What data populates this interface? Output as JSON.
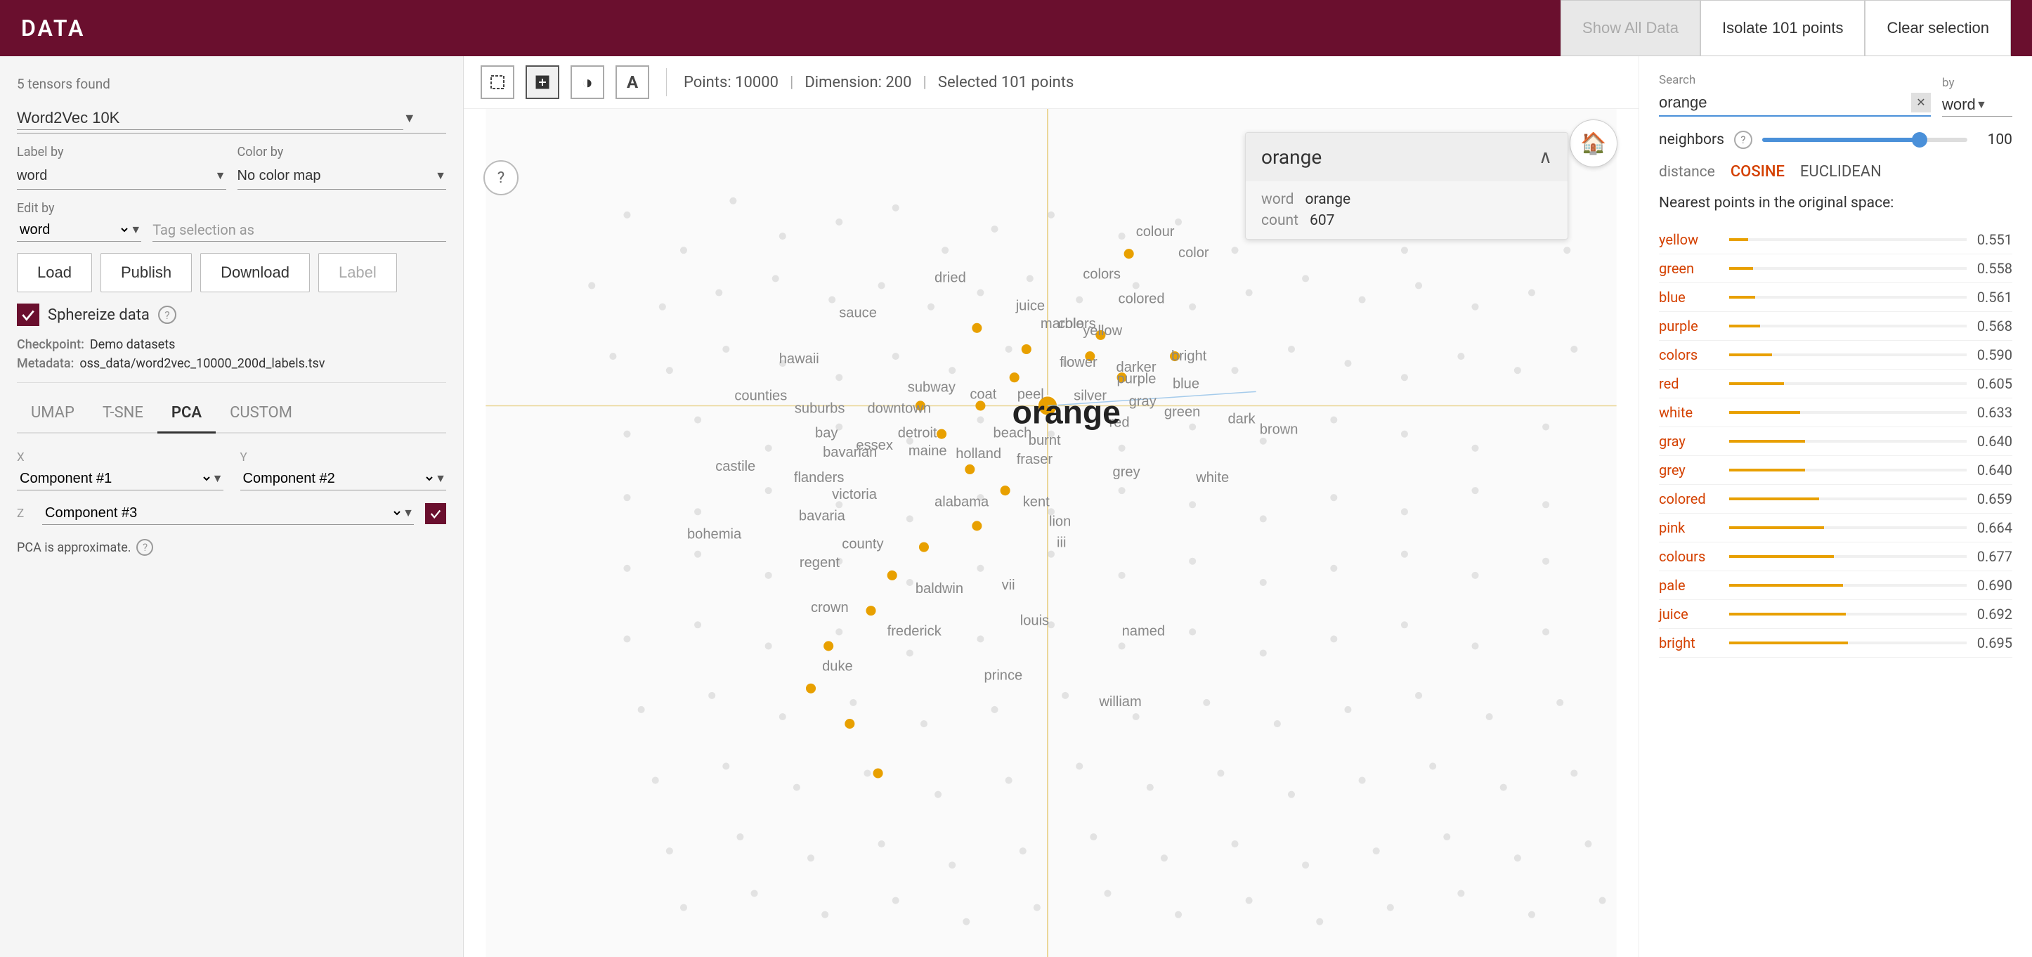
{
  "app": {
    "title": "DATA"
  },
  "top_bar": {
    "show_all_label": "Show All Data",
    "isolate_label": "Isolate 101 points",
    "clear_label": "Clear selection"
  },
  "left_panel": {
    "tensors_found": "5 tensors found",
    "dataset_label": "Word2Vec 10K",
    "label_by_label": "Label by",
    "label_by_value": "word",
    "color_by_label": "Color by",
    "color_by_value": "No color map",
    "edit_by_label": "Edit by",
    "edit_by_value": "word",
    "tag_label": "Tag selection as",
    "tag_placeholder": "",
    "btn_load": "Load",
    "btn_publish": "Publish",
    "btn_download": "Download",
    "btn_label": "Label",
    "sphereize_label": "Sphereize data",
    "checkpoint_label": "Checkpoint:",
    "checkpoint_val": "Demo datasets",
    "metadata_label": "Metadata:",
    "metadata_val": "oss_data/word2vec_10000_200d_labels.tsv",
    "proj_tabs": [
      "UMAP",
      "T-SNE",
      "PCA",
      "CUSTOM"
    ],
    "active_tab": "PCA",
    "axis_x_label": "X",
    "axis_x_value": "Component #1",
    "axis_y_label": "Y",
    "axis_y_value": "Component #2",
    "axis_z_label": "Z",
    "axis_z_value": "Component #3",
    "pca_note": "PCA is approximate."
  },
  "viz": {
    "points_label": "Points: 10000",
    "dimension_label": "Dimension: 200",
    "selected_label": "Selected 101 points",
    "separator": "|",
    "crosshair_icon": "⬚",
    "selection_icon": "⬚",
    "night_icon": "◑",
    "text_icon": "A"
  },
  "popup": {
    "word": "orange",
    "key_word": "word",
    "val_word": "orange",
    "key_count": "count",
    "val_count": "607"
  },
  "right_panel": {
    "search_label": "Search",
    "search_value": "orange",
    "by_label": "by",
    "by_value": "word",
    "neighbors_label": "neighbors",
    "neighbors_value": 100,
    "distance_label": "distance",
    "distance_cosine": "COSINE",
    "distance_euclidean": "EUCLIDEAN",
    "active_distance": "COSINE",
    "nearest_header": "Nearest points in the original space:",
    "nearest_points": [
      {
        "name": "yellow",
        "value": "0.551",
        "bar_pct": 8
      },
      {
        "name": "green",
        "value": "0.558",
        "bar_pct": 10
      },
      {
        "name": "blue",
        "value": "0.561",
        "bar_pct": 11
      },
      {
        "name": "purple",
        "value": "0.568",
        "bar_pct": 13
      },
      {
        "name": "colors",
        "value": "0.590",
        "bar_pct": 18
      },
      {
        "name": "red",
        "value": "0.605",
        "bar_pct": 23
      },
      {
        "name": "white",
        "value": "0.633",
        "bar_pct": 30
      },
      {
        "name": "gray",
        "value": "0.640",
        "bar_pct": 32
      },
      {
        "name": "grey",
        "value": "0.640",
        "bar_pct": 32
      },
      {
        "name": "colored",
        "value": "0.659",
        "bar_pct": 38
      },
      {
        "name": "pink",
        "value": "0.664",
        "bar_pct": 40
      },
      {
        "name": "colours",
        "value": "0.677",
        "bar_pct": 44
      },
      {
        "name": "pale",
        "value": "0.690",
        "bar_pct": 48
      },
      {
        "name": "juice",
        "value": "0.692",
        "bar_pct": 49
      },
      {
        "name": "bright",
        "value": "0.695",
        "bar_pct": 50
      }
    ]
  },
  "scatter": {
    "center_word": "orange",
    "words": [
      {
        "text": "colors",
        "x": 49.5,
        "y": 16
      },
      {
        "text": "colour",
        "x": 57,
        "y": 14
      },
      {
        "text": "color",
        "x": 62.5,
        "y": 17
      },
      {
        "text": "colors",
        "x": 50,
        "y": 20
      },
      {
        "text": "colored",
        "x": 56,
        "y": 22
      },
      {
        "text": "dried",
        "x": 42,
        "y": 21
      },
      {
        "text": "sauce",
        "x": 33,
        "y": 26
      },
      {
        "text": "juice",
        "x": 48,
        "y": 25
      },
      {
        "text": "marble",
        "x": 50,
        "y": 26
      },
      {
        "text": "yellow",
        "x": 53,
        "y": 26
      },
      {
        "text": "hawaii",
        "x": 27,
        "y": 30
      },
      {
        "text": "flower",
        "x": 51,
        "y": 30
      },
      {
        "text": "darker",
        "x": 56,
        "y": 31
      },
      {
        "text": "bright",
        "x": 62,
        "y": 29
      },
      {
        "text": "purple",
        "x": 56,
        "y": 32
      },
      {
        "text": "blue",
        "x": 62,
        "y": 33
      },
      {
        "text": "subway",
        "x": 39,
        "y": 33
      },
      {
        "text": "coat",
        "x": 44,
        "y": 35
      },
      {
        "text": "peel",
        "x": 48,
        "y": 35
      },
      {
        "text": "silver",
        "x": 53,
        "y": 35
      },
      {
        "text": "gray",
        "x": 58,
        "y": 36
      },
      {
        "text": "green",
        "x": 61,
        "y": 37
      },
      {
        "text": "counties",
        "x": 23,
        "y": 35
      },
      {
        "text": "suburbs",
        "x": 28,
        "y": 37
      },
      {
        "text": "downtown",
        "x": 35,
        "y": 37
      },
      {
        "text": "red",
        "x": 57,
        "y": 38
      },
      {
        "text": "dark",
        "x": 66,
        "y": 38
      },
      {
        "text": "bay",
        "x": 30,
        "y": 40
      },
      {
        "text": "detroit",
        "x": 37,
        "y": 40
      },
      {
        "text": "beach",
        "x": 46,
        "y": 40
      },
      {
        "text": "burnt",
        "x": 49,
        "y": 41
      },
      {
        "text": "brown",
        "x": 69,
        "y": 40
      },
      {
        "text": "essex",
        "x": 34,
        "y": 42
      },
      {
        "text": "bavarian",
        "x": 31,
        "y": 42
      },
      {
        "text": "maine",
        "x": 38,
        "y": 42
      },
      {
        "text": "holland",
        "x": 43,
        "y": 42
      },
      {
        "text": "fraser",
        "x": 48,
        "y": 43
      },
      {
        "text": "castile",
        "x": 21,
        "y": 44
      },
      {
        "text": "flanders",
        "x": 28,
        "y": 45
      },
      {
        "text": "grey",
        "x": 56,
        "y": 44
      },
      {
        "text": "white",
        "x": 63,
        "y": 44
      },
      {
        "text": "victoria",
        "x": 32,
        "y": 47
      },
      {
        "text": "alabama",
        "x": 40,
        "y": 47
      },
      {
        "text": "kent",
        "x": 48,
        "y": 47
      },
      {
        "text": "bavaria",
        "x": 28,
        "y": 49
      },
      {
        "text": "lion",
        "x": 50,
        "y": 49
      },
      {
        "text": "county",
        "x": 32,
        "y": 52
      },
      {
        "text": "iii",
        "x": 51,
        "y": 52
      },
      {
        "text": "bohemia",
        "x": 18,
        "y": 50
      },
      {
        "text": "regent",
        "x": 28,
        "y": 54
      },
      {
        "text": "vii",
        "x": 46,
        "y": 57
      },
      {
        "text": "baldwin",
        "x": 38,
        "y": 57
      },
      {
        "text": "crown",
        "x": 29,
        "y": 59
      },
      {
        "text": "louis",
        "x": 48,
        "y": 61
      },
      {
        "text": "frederick",
        "x": 36,
        "y": 62
      },
      {
        "text": "named",
        "x": 57,
        "y": 62
      },
      {
        "text": "duke",
        "x": 30,
        "y": 66
      },
      {
        "text": "prince",
        "x": 45,
        "y": 67
      },
      {
        "text": "william",
        "x": 55,
        "y": 70
      }
    ]
  }
}
